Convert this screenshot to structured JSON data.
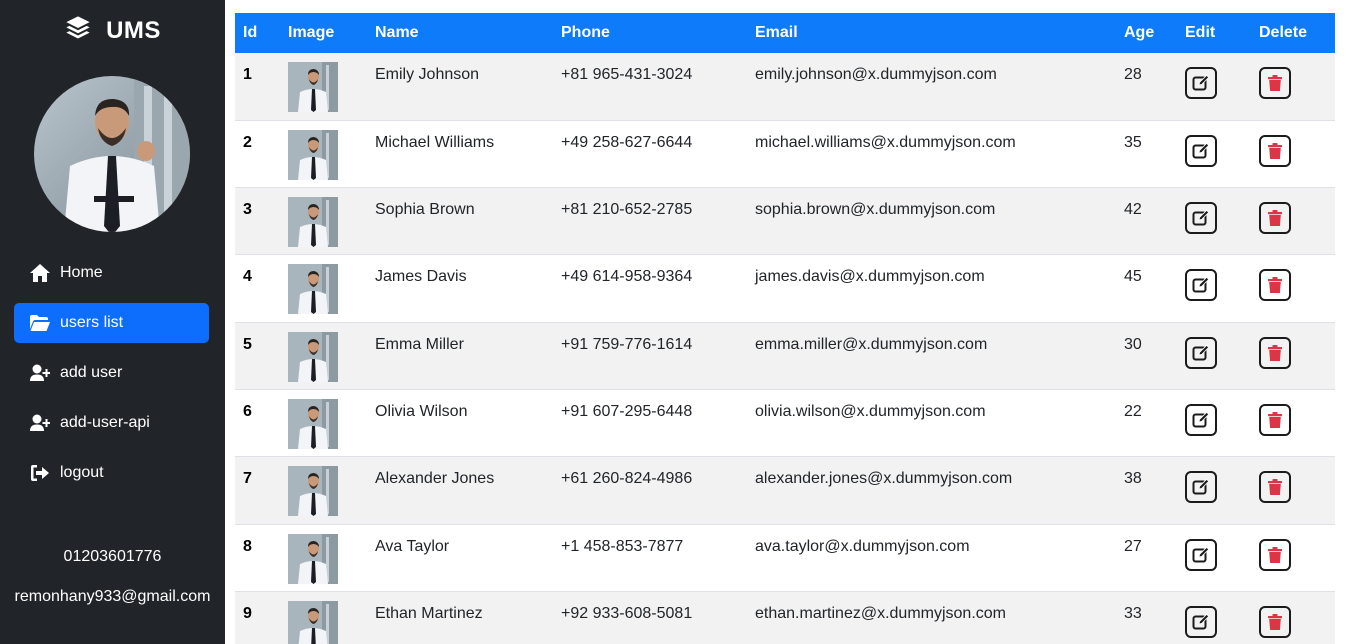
{
  "app": {
    "title": "UMS",
    "logo_icon": "layers-icon"
  },
  "profile": {
    "avatar_alt": "profile photo",
    "phone": "01203601776",
    "email": "remonhany933@gmail.com"
  },
  "sidebar": {
    "items": [
      {
        "label": "Home",
        "icon": "home-icon",
        "active": false
      },
      {
        "label": "users list",
        "icon": "folder-open-icon",
        "active": true
      },
      {
        "label": "add user",
        "icon": "user-plus-icon",
        "active": false
      },
      {
        "label": "add-user-api",
        "icon": "user-plus-icon",
        "active": false
      },
      {
        "label": "logout",
        "icon": "logout-icon",
        "active": false
      }
    ]
  },
  "colors": {
    "sidebar_bg": "#212529",
    "accent": "#0d6efd",
    "table_header": "#0d7bfa",
    "delete_red": "#dc3545"
  },
  "table": {
    "headers": {
      "id": "Id",
      "image": "Image",
      "name": "Name",
      "phone": "Phone",
      "email": "Email",
      "age": "Age",
      "edit": "Edit",
      "delete": "Delete"
    },
    "rows": [
      {
        "id": "1",
        "name": "Emily Johnson",
        "phone": "+81 965-431-3024",
        "email": "emily.johnson@x.dummyjson.com",
        "age": "28"
      },
      {
        "id": "2",
        "name": "Michael Williams",
        "phone": "+49 258-627-6644",
        "email": "michael.williams@x.dummyjson.com",
        "age": "35"
      },
      {
        "id": "3",
        "name": "Sophia Brown",
        "phone": "+81 210-652-2785",
        "email": "sophia.brown@x.dummyjson.com",
        "age": "42"
      },
      {
        "id": "4",
        "name": "James Davis",
        "phone": "+49 614-958-9364",
        "email": "james.davis@x.dummyjson.com",
        "age": "45"
      },
      {
        "id": "5",
        "name": "Emma Miller",
        "phone": "+91 759-776-1614",
        "email": "emma.miller@x.dummyjson.com",
        "age": "30"
      },
      {
        "id": "6",
        "name": "Olivia Wilson",
        "phone": "+91 607-295-6448",
        "email": "olivia.wilson@x.dummyjson.com",
        "age": "22"
      },
      {
        "id": "7",
        "name": "Alexander Jones",
        "phone": "+61 260-824-4986",
        "email": "alexander.jones@x.dummyjson.com",
        "age": "38"
      },
      {
        "id": "8",
        "name": "Ava Taylor",
        "phone": "+1 458-853-7877",
        "email": "ava.taylor@x.dummyjson.com",
        "age": "27"
      },
      {
        "id": "9",
        "name": "Ethan Martinez",
        "phone": "+92 933-608-5081",
        "email": "ethan.martinez@x.dummyjson.com",
        "age": "33"
      }
    ]
  }
}
